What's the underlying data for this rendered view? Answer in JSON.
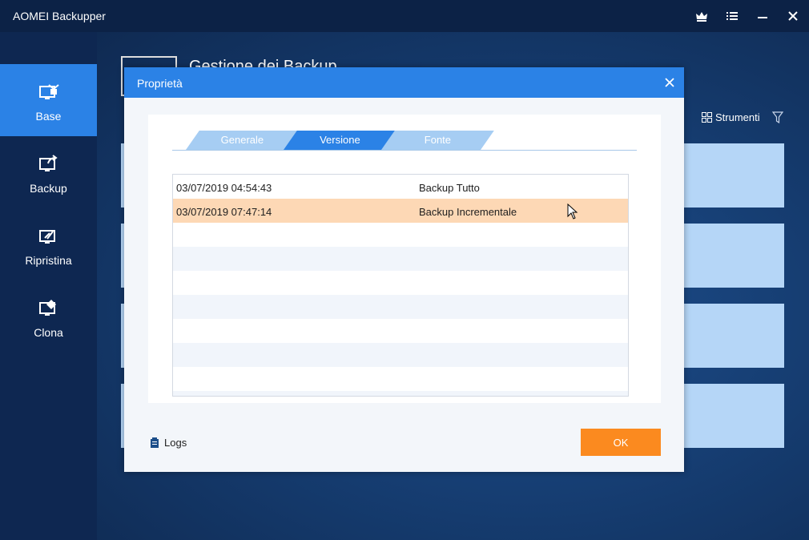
{
  "app": {
    "title": "AOMEI Backupper"
  },
  "titlebar_icons": [
    "crown-icon",
    "menu-icon",
    "minimize-icon",
    "close-icon"
  ],
  "sidebar": {
    "items": [
      {
        "label": "Base",
        "icon": "home-monitor-icon",
        "active": true
      },
      {
        "label": "Backup",
        "icon": "backup-monitor-icon",
        "active": false
      },
      {
        "label": "Ripristina",
        "icon": "restore-monitor-icon",
        "active": false
      },
      {
        "label": "Clona",
        "icon": "clone-monitor-icon",
        "active": false
      }
    ]
  },
  "background": {
    "heading": "Gestione dei Backup",
    "tools_label": "Strumenti"
  },
  "dialog": {
    "title": "Proprietà",
    "tabs": [
      {
        "label": "Generale",
        "active": false
      },
      {
        "label": "Versione",
        "active": true
      },
      {
        "label": "Fonte",
        "active": false
      }
    ],
    "versions": [
      {
        "date": "03/07/2019 04:54:43",
        "type": "Backup Tutto",
        "selected": false
      },
      {
        "date": "03/07/2019 07:47:14",
        "type": "Backup Incrementale",
        "selected": true
      }
    ],
    "logs_label": "Logs",
    "ok_label": "OK"
  },
  "colors": {
    "accent": "#2b82e6",
    "ok_button": "#fb8a1f",
    "selected_row": "#fdd8b5",
    "tab_inactive": "#a6cdf3"
  }
}
